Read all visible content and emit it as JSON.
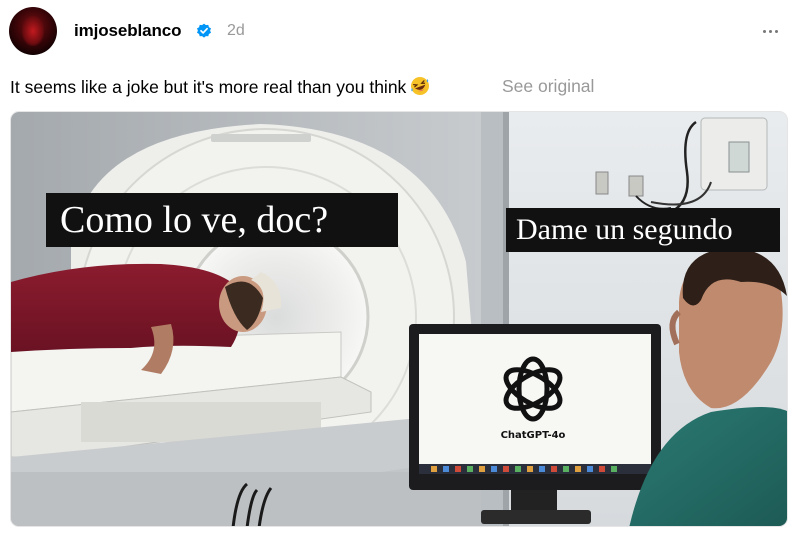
{
  "post": {
    "username": "imjoseblanco",
    "time_ago": "2d",
    "caption": "It seems like a joke but it's more real than you think",
    "see_original": "See original"
  },
  "meme": {
    "left_caption": "Como lo ve, doc?",
    "right_caption": "Dame un segundo",
    "screen_text": "ChatGPT-4o"
  },
  "icons": {
    "verified": "verified-badge-icon",
    "more": "more-options-icon",
    "emoji": "rolling-laughing-emoji",
    "logo": "openai-logo-icon"
  },
  "colors": {
    "verified": "#0095f6",
    "muted_text": "#999999",
    "avatar": "#7a0f12"
  }
}
